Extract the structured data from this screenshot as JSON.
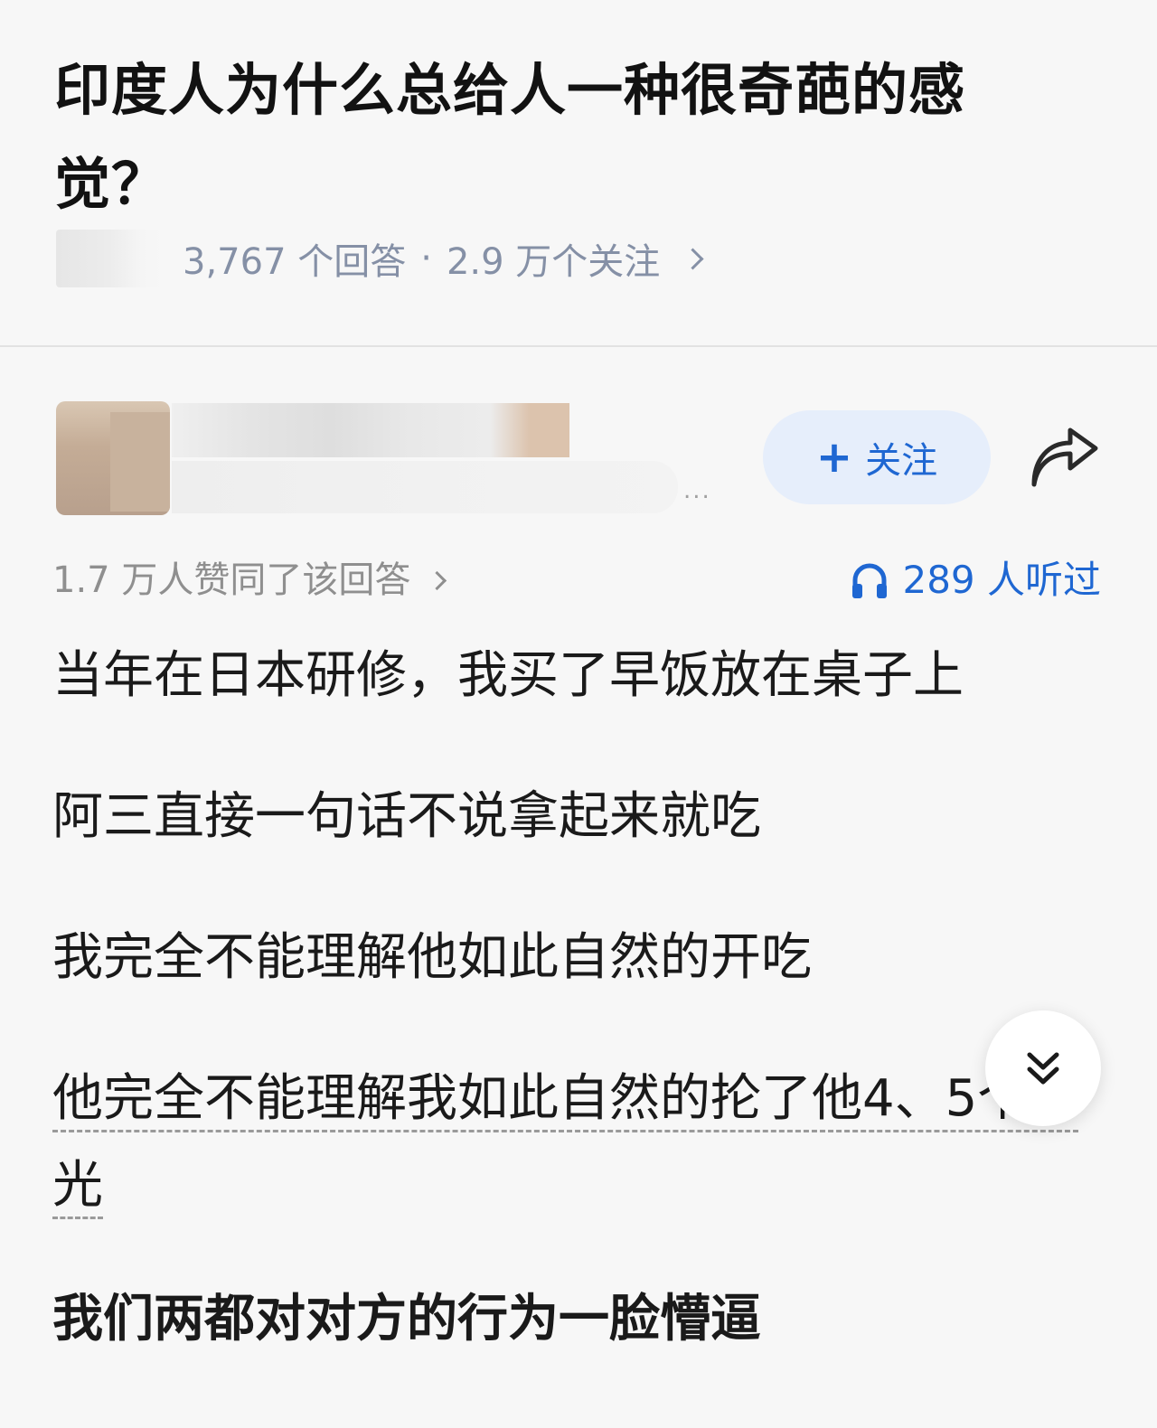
{
  "question": {
    "title": "印度人为什么总给人一种很奇葩的感觉？",
    "answer_count": "3,767 个回答",
    "separator": "·",
    "follower_count": "2.9 万个关注"
  },
  "author": {
    "bio_ellipsis": "...",
    "follow_label": "关注",
    "follow_plus": "+"
  },
  "stats": {
    "approval_text": "1.7 万人赞同了该回答",
    "listen_count": "289 人听过"
  },
  "answer": {
    "paragraphs": [
      "当年在日本研修，我买了早饭放在桌子上",
      "阿三直接一句话不说拿起来就吃",
      "我完全不能理解他如此自然的开吃",
      "他完全不能理解我如此自然的抡了他4、5个耳光",
      "我们两都对对方的行为一脸懵逼"
    ],
    "p4_line1": "他完全不能理解我如此自然的抡了他4、",
    "p4_line2": "耳光"
  },
  "colors": {
    "background": "#f7f7f7",
    "accent_blue": "#1f67d2",
    "follow_bg": "#e6eefb",
    "meta_gray": "#8590a6"
  },
  "icons": [
    "share-icon",
    "headphone-icon",
    "chevron-right-icon",
    "double-chevron-down-icon",
    "plus-icon"
  ]
}
